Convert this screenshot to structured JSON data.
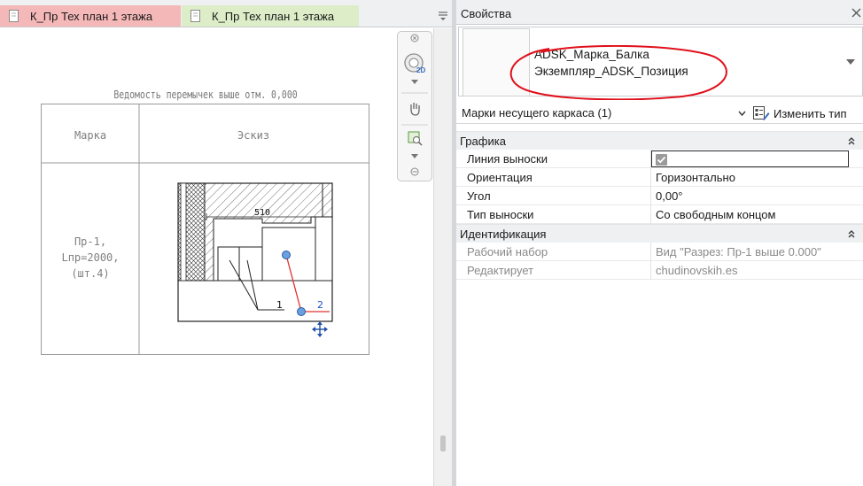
{
  "tabs": [
    {
      "label": "К_Пр Тех план 1 этажа",
      "color": "#f5b8b8"
    },
    {
      "label": "К_Пр Тех план 1 этажа",
      "color": "#dcedc8"
    }
  ],
  "drawing": {
    "table_title": "Ведомость перемычек выше отм. 0,000",
    "col_mark": "Марка",
    "col_sketch": "Эскиз",
    "row_mark_lines": [
      "Пр-1,",
      "Lпр=2000,",
      "(шт.4)"
    ],
    "dimension_label": "510",
    "leader_1": "1",
    "leader_2": "2"
  },
  "properties": {
    "title": "Свойства",
    "type_name_line1": "ADSK_Марка_Балка",
    "type_name_line2": "Экземпляр_ADSK_Позиция",
    "selector": "Марки несущего каркаса (1)",
    "edit_type_label": "Изменить тип",
    "groups": [
      {
        "label": "Графика",
        "rows": [
          {
            "name": "Линия выноски",
            "value": "",
            "checkbox": true
          },
          {
            "name": "Ориентация",
            "value": "Горизонтально"
          },
          {
            "name": "Угол",
            "value": "0,00°"
          },
          {
            "name": "Тип выноски",
            "value": "Со свободным концом"
          }
        ]
      },
      {
        "label": "Идентификация",
        "rows": [
          {
            "name": "Рабочий набор",
            "value": "Вид \"Разрез: Пр-1 выше 0.000\"",
            "disabled": true
          },
          {
            "name": "Редактирует",
            "value": "chudinovskih.es",
            "disabled": true
          }
        ]
      }
    ]
  },
  "colors": {
    "annotation_red": "#e0101a",
    "leader_red": "#e03030",
    "grip_blue": "#6a9fe0"
  },
  "icons": [
    "document-icon",
    "dropdown-menu-icon",
    "close-icon",
    "steering-wheel-2d-icon",
    "pan-icon",
    "zoom-region-icon",
    "move-grip-icon",
    "edit-type-icon",
    "collapse-icon"
  ]
}
